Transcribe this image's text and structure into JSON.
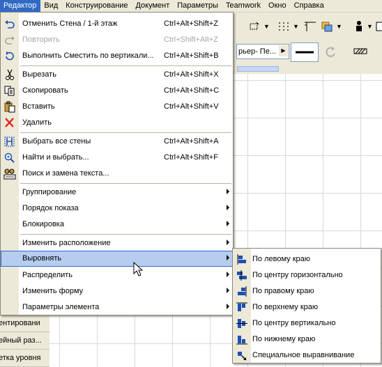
{
  "menubar": {
    "items": [
      {
        "label": "Редактор",
        "active": true
      },
      {
        "label": "Вид"
      },
      {
        "label": "Конструирование"
      },
      {
        "label": "Документ"
      },
      {
        "label": "Параметры"
      },
      {
        "label": "Teamwork"
      },
      {
        "label": "Окно"
      },
      {
        "label": "Справка"
      }
    ]
  },
  "toolbar": {
    "combo_value": "рьер- Пе..."
  },
  "left_panel": {
    "rows": [
      "ентировани",
      "ейный раз...",
      "етка уровня"
    ]
  },
  "edit_menu": {
    "undo": {
      "label": "Отменить Стена / 1-й этаж",
      "shortcut": "Ctrl+Alt+Shift+Z",
      "icon": "undo-icon"
    },
    "redo": {
      "label": "Повторить",
      "shortcut": "Ctrl+Shift+Alt+Z",
      "icon": "redo-icon",
      "disabled": true
    },
    "repeat": {
      "label": "Выполнить Сместить по вертикали...",
      "shortcut": "Ctrl+Alt+Shift+B",
      "icon": "repeat-icon"
    },
    "cut": {
      "label": "Вырезать",
      "shortcut": "Ctrl+Alt+Shift+X",
      "icon": "scissors-icon"
    },
    "copy": {
      "label": "Скопировать",
      "shortcut": "Ctrl+Alt+Shift+C",
      "icon": "copy-icon"
    },
    "paste": {
      "label": "Вставить",
      "shortcut": "Ctrl+Alt+Shift+V",
      "icon": "paste-icon"
    },
    "delete": {
      "label": "Удалить",
      "icon": "delete-x-icon"
    },
    "select_all": {
      "label": "Выбрать все стены",
      "shortcut": "Ctrl+Alt+Shift+A",
      "icon": "select-walls-icon"
    },
    "find_select": {
      "label": "Найти и выбрать...",
      "shortcut": "Ctrl+Alt+Shift+F",
      "icon": "find-select-icon"
    },
    "find_replace": {
      "label": "Поиск и замена текста...",
      "icon": "find-replace-text-icon"
    },
    "grouping": {
      "label": "Группирование"
    },
    "display_order": {
      "label": "Порядок показа"
    },
    "locking": {
      "label": "Блокировка"
    },
    "reshape_position": {
      "label": "Изменить расположение"
    },
    "align": {
      "label": "Выровнять"
    },
    "distribute": {
      "label": "Распределить"
    },
    "reshape": {
      "label": "Изменить форму"
    },
    "element_settings": {
      "label": "Параметры элемента"
    }
  },
  "align_submenu": {
    "items": [
      {
        "label": "По левому краю",
        "icon": "align-left-icon"
      },
      {
        "label": "По центру горизонтально",
        "icon": "align-center-horizontal-icon"
      },
      {
        "label": "По правому краю",
        "icon": "align-right-icon"
      },
      {
        "label": "По верхнему краю",
        "icon": "align-top-icon"
      },
      {
        "label": "По центру вертикально",
        "icon": "align-center-vertical-icon"
      },
      {
        "label": "По нижнему краю",
        "icon": "align-bottom-icon"
      },
      {
        "label": "Специальное выравнивание",
        "icon": "special-align-icon"
      }
    ]
  },
  "colors": {
    "menu_highlight": "#b6cdf0",
    "menubar_active": "#316ac5",
    "icon_blue": "#1e50b4"
  }
}
